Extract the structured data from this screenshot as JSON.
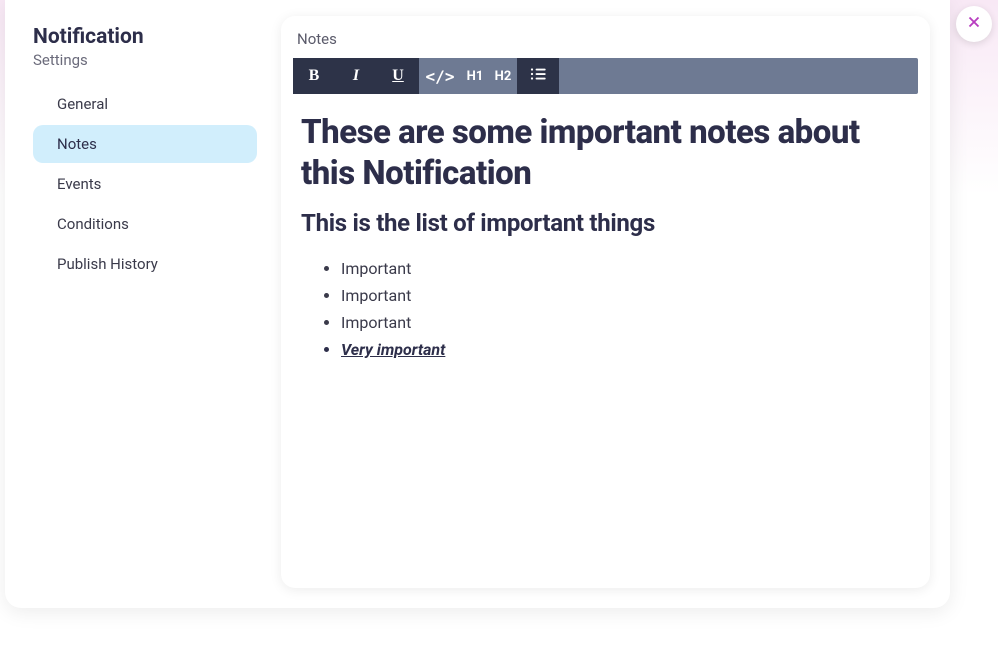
{
  "sidebar": {
    "title": "Notification",
    "subtitle": "Settings",
    "items": [
      {
        "label": "General",
        "active": false
      },
      {
        "label": "Notes",
        "active": true
      },
      {
        "label": "Events",
        "active": false
      },
      {
        "label": "Conditions",
        "active": false
      },
      {
        "label": "Publish History",
        "active": false
      }
    ]
  },
  "panel": {
    "header": "Notes"
  },
  "toolbar": {
    "bold": "B",
    "italic": "I",
    "underline": "U",
    "code": "</>",
    "h1": "H1",
    "h2": "H2"
  },
  "editor": {
    "heading1": "These are some important notes about this Notification",
    "heading2": "This is the list of important things",
    "bullets": [
      {
        "text": "Important",
        "emphasized": false
      },
      {
        "text": "Important",
        "emphasized": false
      },
      {
        "text": "Important",
        "emphasized": false
      },
      {
        "text": "Very important",
        "emphasized": true
      }
    ]
  }
}
